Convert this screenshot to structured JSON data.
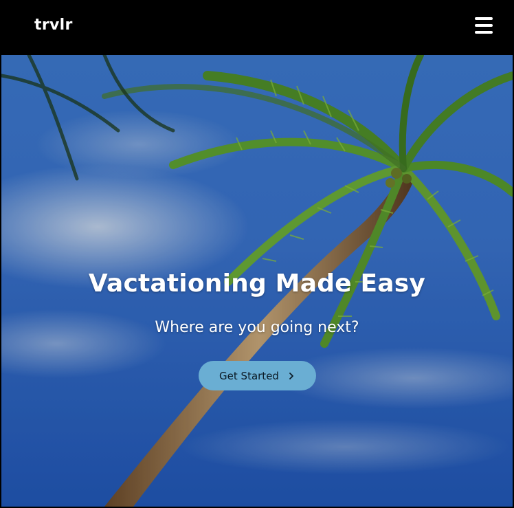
{
  "navbar": {
    "logo": "trvlr",
    "menu_icon": "hamburger-menu-icon"
  },
  "hero": {
    "title": "Vactationing Made Easy",
    "subtitle": "Where are you going next?",
    "cta_label": "Get Started",
    "cta_icon": "chevron-right-icon",
    "background_image": "palm-tree-beach-sky-photo"
  },
  "colors": {
    "navbar_bg": "#000000",
    "text": "#ffffff",
    "cta_bg": "#6aaed3",
    "cta_text": "#0b1a25",
    "sky": "#2f6bc9"
  }
}
